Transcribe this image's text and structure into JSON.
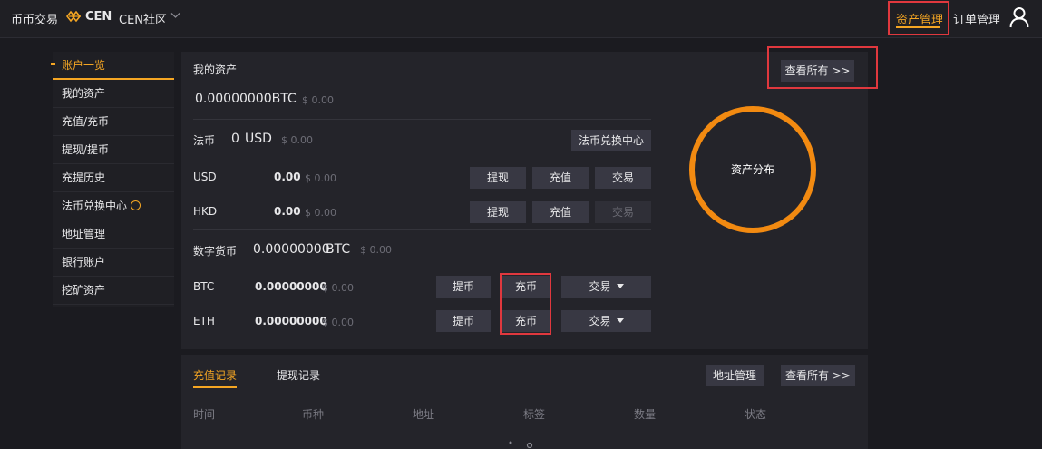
{
  "topbar": {
    "nav_trade": "币币交易",
    "brand": "CEN",
    "community": "CEN社区",
    "asset_mgmt": "资产管理",
    "order_mgmt": "订单管理"
  },
  "sidebar": {
    "items": [
      "账户一览",
      "我的资产",
      "充值/充币",
      "提现/提币",
      "充提历史",
      "法币兑换中心",
      "地址管理",
      "银行账户",
      "挖矿资产"
    ]
  },
  "assets": {
    "title": "我的资产",
    "view_all": "查看所有 >>",
    "total_btc": "0.00000000",
    "total_unit": "BTC",
    "total_usd": "$ 0.00",
    "distribution_label": "资产分布"
  },
  "fiat": {
    "label": "法币",
    "amount": "0",
    "unit": "USD",
    "usd": "$ 0.00",
    "exchange_center": "法币兑换中心",
    "rows": [
      {
        "currency": "USD",
        "amount": "0.00",
        "usd": "$ 0.00"
      },
      {
        "currency": "HKD",
        "amount": "0.00",
        "usd": "$ 0.00"
      }
    ],
    "btn_withdraw": "提现",
    "btn_deposit": "充值",
    "btn_trade": "交易"
  },
  "crypto": {
    "label": "数字货币",
    "amount": "0.00000000",
    "unit": "BTC",
    "usd": "$ 0.00",
    "rows": [
      {
        "currency": "BTC",
        "amount": "0.00000000",
        "usd": "$ 0.00"
      },
      {
        "currency": "ETH",
        "amount": "0.00000000",
        "usd": "$ 0.00"
      }
    ],
    "btn_withdraw": "提币",
    "btn_deposit": "充币",
    "btn_trade": "交易"
  },
  "records": {
    "tab_deposit": "充值记录",
    "tab_withdraw": "提现记录",
    "address_mgmt": "地址管理",
    "view_all": "查看所有 >>",
    "columns": [
      "时间",
      "币种",
      "地址",
      "标签",
      "数量",
      "状态"
    ]
  },
  "colors": {
    "accent": "#f5a623",
    "highlight_box": "#e0383e",
    "ring": "#f28a11"
  }
}
